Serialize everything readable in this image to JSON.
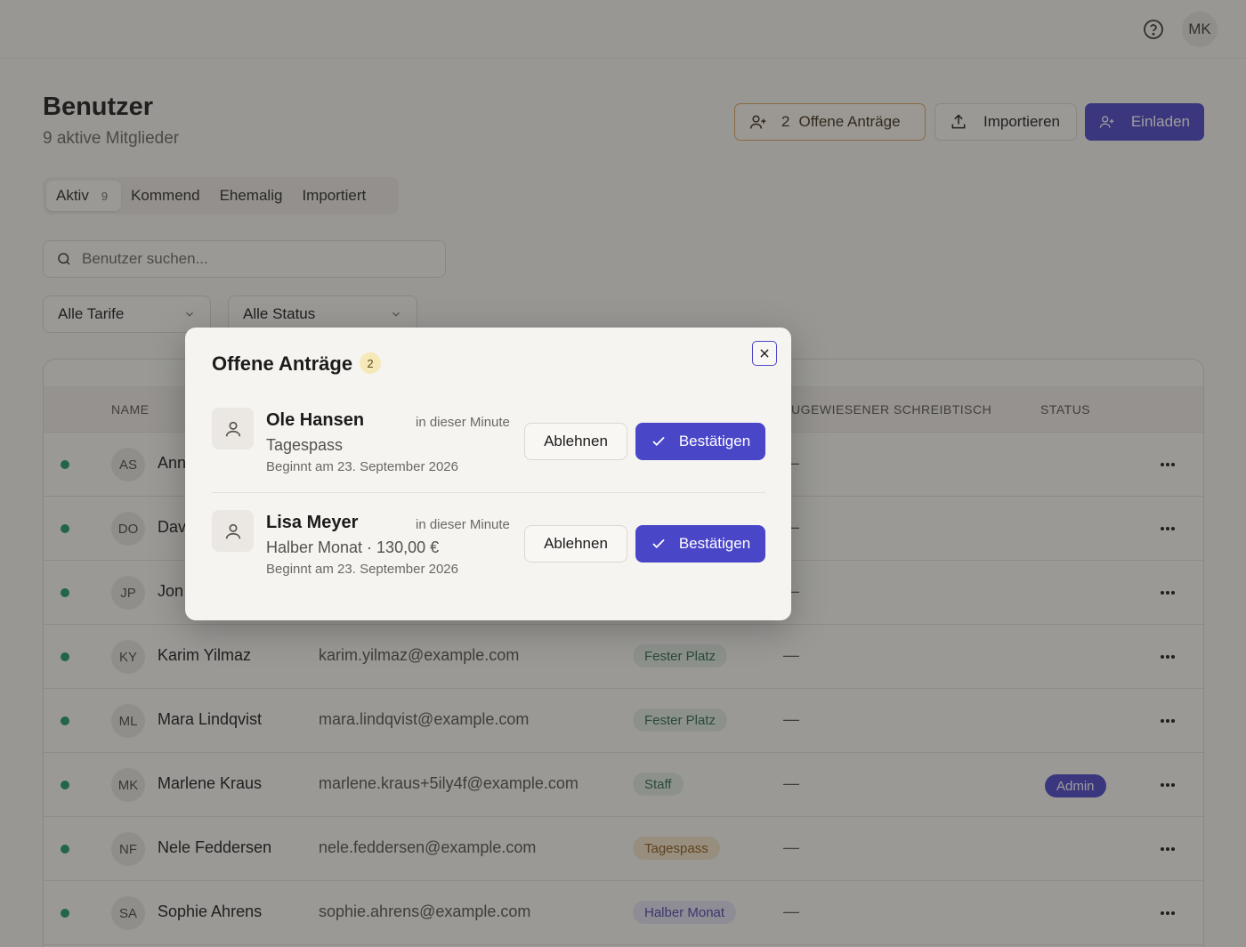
{
  "topbar": {
    "avatar_initials": "MK",
    "help_icon": "help-circle-icon"
  },
  "header": {
    "title": "Benutzer",
    "subtitle": "9 aktive Mitglieder",
    "pending_button": {
      "count": "2",
      "label": "Offene Anträge"
    },
    "import_button": "Importieren",
    "invite_button": "Einladen"
  },
  "tabs": [
    {
      "label": "Aktiv",
      "count": "9"
    },
    {
      "label": "Kommend"
    },
    {
      "label": "Ehemalig"
    },
    {
      "label": "Importiert"
    }
  ],
  "search": {
    "placeholder": "Benutzer suchen..."
  },
  "filters": {
    "tarife": "Alle Tarife",
    "status": "Alle Status"
  },
  "table": {
    "columns": {
      "name": "NAME",
      "desk": "ZUGEWIESENER SCHREIBTISCH",
      "status": "STATUS"
    },
    "rows": [
      {
        "initials": "AS",
        "name": "Ann",
        "email": "",
        "plan": "",
        "desk": "—",
        "status": ""
      },
      {
        "initials": "DO",
        "name": "Dav",
        "email": "",
        "plan": "",
        "desk": "—",
        "status": ""
      },
      {
        "initials": "JP",
        "name": "Jon",
        "email": "",
        "plan": "",
        "desk": "—",
        "status": ""
      },
      {
        "initials": "KY",
        "name": "Karim Yilmaz",
        "email": "karim.yilmaz@example.com",
        "plan": "Fester Platz",
        "desk": "—",
        "status": ""
      },
      {
        "initials": "ML",
        "name": "Mara Lindqvist",
        "email": "mara.lindqvist@example.com",
        "plan": "Fester Platz",
        "desk": "—",
        "status": ""
      },
      {
        "initials": "MK",
        "name": "Marlene Kraus",
        "email": "marlene.kraus+5ily4f@example.com",
        "plan": "Staff",
        "desk": "—",
        "status": "Admin"
      },
      {
        "initials": "NF",
        "name": "Nele Feddersen",
        "email": "nele.feddersen@example.com",
        "plan": "Tagespass",
        "desk": "—",
        "status": ""
      },
      {
        "initials": "SA",
        "name": "Sophie Ahrens",
        "email": "sophie.ahrens@example.com",
        "plan": "Halber Monat",
        "desk": "—",
        "status": ""
      }
    ]
  },
  "modal": {
    "title": "Offene Anträge",
    "count": "2",
    "requests": [
      {
        "name": "Ole Hansen",
        "time": "in dieser Minute",
        "plan": "Tagespass",
        "start": "Beginnt am 23. September 2026",
        "decline": "Ablehnen",
        "confirm": "Bestätigen"
      },
      {
        "name": "Lisa Meyer",
        "time": "in dieser Minute",
        "plan": "Halber Monat · 130,00 €",
        "start": "Beginnt am 23. September 2026",
        "decline": "Ablehnen",
        "confirm": "Bestätigen"
      }
    ]
  },
  "colors": {
    "accent": "#4a46c8",
    "status_dot": "#1e9a6a",
    "pending_border": "#d9a35a"
  }
}
